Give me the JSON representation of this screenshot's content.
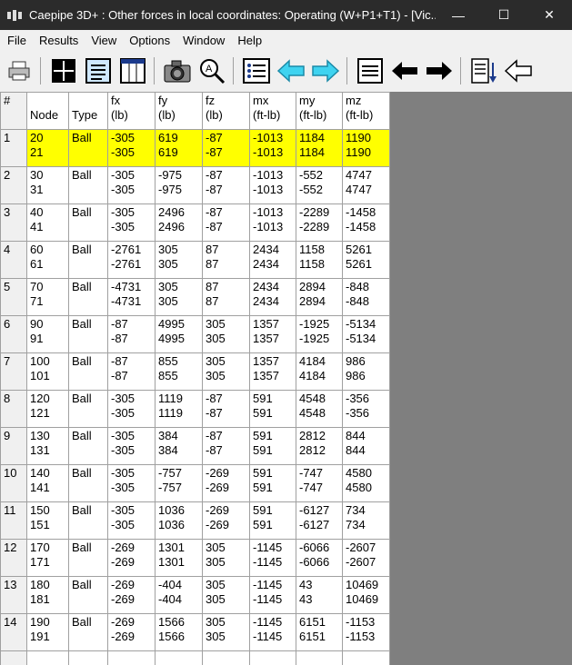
{
  "window": {
    "title": "Caepipe 3D+ : Other forces in local coordinates: Operating (W+P1+T1) -  [Vic...",
    "minimize": "—",
    "maximize": "☐",
    "close": "✕"
  },
  "menu": [
    "File",
    "Results",
    "View",
    "Options",
    "Window",
    "Help"
  ],
  "toolbar": [
    "print-icon",
    "grid-icon",
    "text-list-icon",
    "columns-icon",
    "camera-icon",
    "zoom-icon",
    "list-icon",
    "arrow-left-cyan-icon",
    "arrow-right-cyan-icon",
    "lines-icon",
    "arrow-left-black-icon",
    "arrow-right-black-icon",
    "sort-down-icon",
    "arrow-left-outline-icon"
  ],
  "table": {
    "headers": [
      {
        "top": "#",
        "bottom": ""
      },
      {
        "top": "",
        "bottom": "Node"
      },
      {
        "top": "",
        "bottom": "Type"
      },
      {
        "top": "fx",
        "bottom": "(lb)"
      },
      {
        "top": "fy",
        "bottom": "(lb)"
      },
      {
        "top": "fz",
        "bottom": "(lb)"
      },
      {
        "top": "mx",
        "bottom": "(ft-lb)"
      },
      {
        "top": "my",
        "bottom": "(ft-lb)"
      },
      {
        "top": "mz",
        "bottom": "(ft-lb)"
      }
    ],
    "rows": [
      {
        "idx": "1",
        "node": [
          "20",
          "21"
        ],
        "type": "Ball",
        "fx": [
          "-305",
          "-305"
        ],
        "fy": [
          "619",
          "619"
        ],
        "fz": [
          "-87",
          "-87"
        ],
        "mx": [
          "-1013",
          "-1013"
        ],
        "my": [
          "1184",
          "1184"
        ],
        "mz": [
          "1190",
          "1190"
        ]
      },
      {
        "idx": "2",
        "node": [
          "30",
          "31"
        ],
        "type": "Ball",
        "fx": [
          "-305",
          "-305"
        ],
        "fy": [
          "-975",
          "-975"
        ],
        "fz": [
          "-87",
          "-87"
        ],
        "mx": [
          "-1013",
          "-1013"
        ],
        "my": [
          "-552",
          "-552"
        ],
        "mz": [
          "4747",
          "4747"
        ]
      },
      {
        "idx": "3",
        "node": [
          "40",
          "41"
        ],
        "type": "Ball",
        "fx": [
          "-305",
          "-305"
        ],
        "fy": [
          "2496",
          "2496"
        ],
        "fz": [
          "-87",
          "-87"
        ],
        "mx": [
          "-1013",
          "-1013"
        ],
        "my": [
          "-2289",
          "-2289"
        ],
        "mz": [
          "-1458",
          "-1458"
        ]
      },
      {
        "idx": "4",
        "node": [
          "60",
          "61"
        ],
        "type": "Ball",
        "fx": [
          "-2761",
          "-2761"
        ],
        "fy": [
          "305",
          "305"
        ],
        "fz": [
          "87",
          "87"
        ],
        "mx": [
          "2434",
          "2434"
        ],
        "my": [
          "1158",
          "1158"
        ],
        "mz": [
          "5261",
          "5261"
        ]
      },
      {
        "idx": "5",
        "node": [
          "70",
          "71"
        ],
        "type": "Ball",
        "fx": [
          "-4731",
          "-4731"
        ],
        "fy": [
          "305",
          "305"
        ],
        "fz": [
          "87",
          "87"
        ],
        "mx": [
          "2434",
          "2434"
        ],
        "my": [
          "2894",
          "2894"
        ],
        "mz": [
          "-848",
          "-848"
        ]
      },
      {
        "idx": "6",
        "node": [
          "90",
          "91"
        ],
        "type": "Ball",
        "fx": [
          "-87",
          "-87"
        ],
        "fy": [
          "4995",
          "4995"
        ],
        "fz": [
          "305",
          "305"
        ],
        "mx": [
          "1357",
          "1357"
        ],
        "my": [
          "-1925",
          "-1925"
        ],
        "mz": [
          "-5134",
          "-5134"
        ]
      },
      {
        "idx": "7",
        "node": [
          "100",
          "101"
        ],
        "type": "Ball",
        "fx": [
          "-87",
          "-87"
        ],
        "fy": [
          "855",
          "855"
        ],
        "fz": [
          "305",
          "305"
        ],
        "mx": [
          "1357",
          "1357"
        ],
        "my": [
          "4184",
          "4184"
        ],
        "mz": [
          "986",
          "986"
        ]
      },
      {
        "idx": "8",
        "node": [
          "120",
          "121"
        ],
        "type": "Ball",
        "fx": [
          "-305",
          "-305"
        ],
        "fy": [
          "1119",
          "1119"
        ],
        "fz": [
          "-87",
          "-87"
        ],
        "mx": [
          "591",
          "591"
        ],
        "my": [
          "4548",
          "4548"
        ],
        "mz": [
          "-356",
          "-356"
        ]
      },
      {
        "idx": "9",
        "node": [
          "130",
          "131"
        ],
        "type": "Ball",
        "fx": [
          "-305",
          "-305"
        ],
        "fy": [
          "384",
          "384"
        ],
        "fz": [
          "-87",
          "-87"
        ],
        "mx": [
          "591",
          "591"
        ],
        "my": [
          "2812",
          "2812"
        ],
        "mz": [
          "844",
          "844"
        ]
      },
      {
        "idx": "10",
        "node": [
          "140",
          "141"
        ],
        "type": "Ball",
        "fx": [
          "-305",
          "-305"
        ],
        "fy": [
          "-757",
          "-757"
        ],
        "fz": [
          "-269",
          "-269"
        ],
        "mx": [
          "591",
          "591"
        ],
        "my": [
          "-747",
          "-747"
        ],
        "mz": [
          "4580",
          "4580"
        ]
      },
      {
        "idx": "11",
        "node": [
          "150",
          "151"
        ],
        "type": "Ball",
        "fx": [
          "-305",
          "-305"
        ],
        "fy": [
          "1036",
          "1036"
        ],
        "fz": [
          "-269",
          "-269"
        ],
        "mx": [
          "591",
          "591"
        ],
        "my": [
          "-6127",
          "-6127"
        ],
        "mz": [
          "734",
          "734"
        ]
      },
      {
        "idx": "12",
        "node": [
          "170",
          "171"
        ],
        "type": "Ball",
        "fx": [
          "-269",
          "-269"
        ],
        "fy": [
          "1301",
          "1301"
        ],
        "fz": [
          "305",
          "305"
        ],
        "mx": [
          "-1145",
          "-1145"
        ],
        "my": [
          "-6066",
          "-6066"
        ],
        "mz": [
          "-2607",
          "-2607"
        ]
      },
      {
        "idx": "13",
        "node": [
          "180",
          "181"
        ],
        "type": "Ball",
        "fx": [
          "-269",
          "-269"
        ],
        "fy": [
          "-404",
          "-404"
        ],
        "fz": [
          "305",
          "305"
        ],
        "mx": [
          "-1145",
          "-1145"
        ],
        "my": [
          "43",
          "43"
        ],
        "mz": [
          "10469",
          "10469"
        ]
      },
      {
        "idx": "14",
        "node": [
          "190",
          "191"
        ],
        "type": "Ball",
        "fx": [
          "-269",
          "-269"
        ],
        "fy": [
          "1566",
          "1566"
        ],
        "fz": [
          "305",
          "305"
        ],
        "mx": [
          "-1145",
          "-1145"
        ],
        "my": [
          "6151",
          "6151"
        ],
        "mz": [
          "-1153",
          "-1153"
        ]
      }
    ],
    "selected_row": 0
  },
  "colors": {
    "selected": "#ffff00",
    "titlebar": "#2b2b2b",
    "background": "#7f7f7f"
  }
}
